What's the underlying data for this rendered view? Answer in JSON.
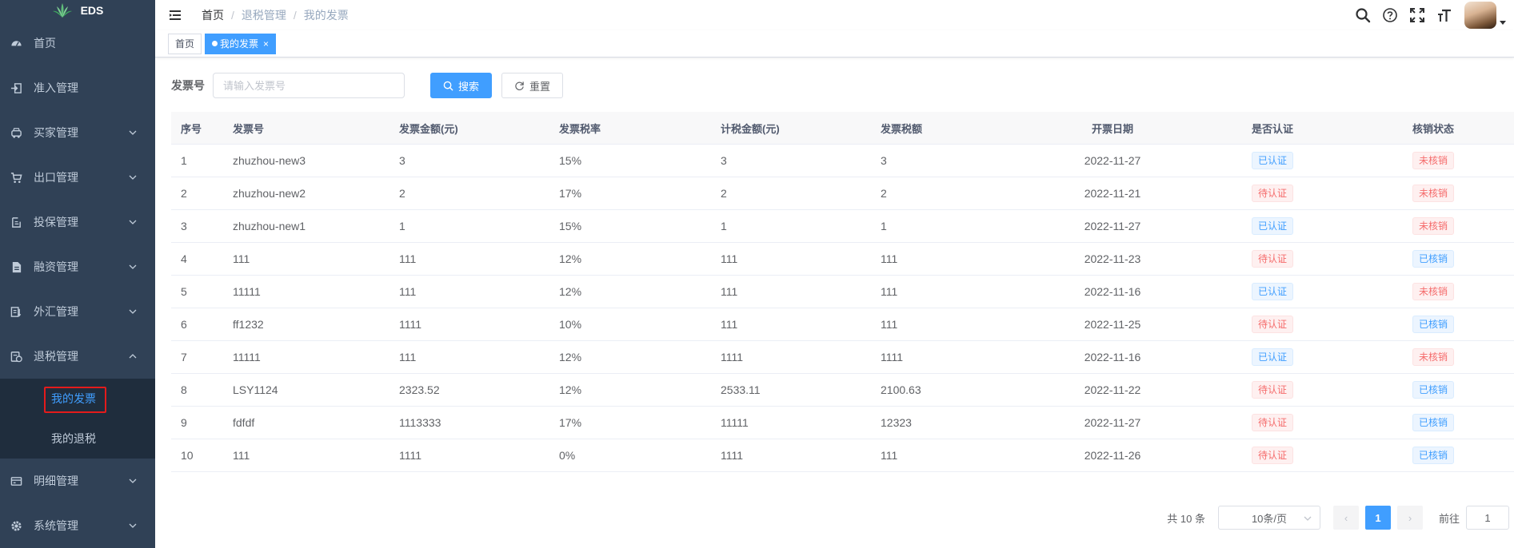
{
  "app": {
    "logo_text": "EDS"
  },
  "sidebar": {
    "items": [
      {
        "label": "首页",
        "icon": "dashboard-icon",
        "expandable": false
      },
      {
        "label": "准入管理",
        "icon": "entry-icon",
        "expandable": false
      },
      {
        "label": "买家管理",
        "icon": "buyer-icon",
        "expandable": true
      },
      {
        "label": "出口管理",
        "icon": "cart-icon",
        "expandable": true
      },
      {
        "label": "投保管理",
        "icon": "insurance-icon",
        "expandable": true
      },
      {
        "label": "融资管理",
        "icon": "finance-icon",
        "expandable": true
      },
      {
        "label": "外汇管理",
        "icon": "exchange-icon",
        "expandable": true
      },
      {
        "label": "退税管理",
        "icon": "tax-refund-icon",
        "expandable": true,
        "expanded": true
      }
    ],
    "submenu": [
      {
        "label": "我的发票",
        "active": true
      },
      {
        "label": "我的退税",
        "active": false
      }
    ],
    "items_after": [
      {
        "label": "明细管理",
        "icon": "detail-icon",
        "expandable": true
      },
      {
        "label": "系统管理",
        "icon": "system-icon",
        "expandable": true
      }
    ]
  },
  "header": {
    "breadcrumb": [
      "首页",
      "退税管理",
      "我的发票"
    ],
    "separator": "/"
  },
  "tags": [
    {
      "label": "首页",
      "active": false
    },
    {
      "label": "我的发票",
      "active": true,
      "close": "×"
    }
  ],
  "search": {
    "label": "发票号",
    "placeholder": "请输入发票号",
    "value": "",
    "search_label": "搜索",
    "reset_label": "重置"
  },
  "table": {
    "columns": [
      "序号",
      "发票号",
      "发票金额(元)",
      "发票税率",
      "计税金额(元)",
      "发票税额",
      "开票日期",
      "是否认证",
      "核销状态"
    ],
    "rows": [
      [
        "1",
        "zhuzhou-new3",
        "3",
        "15%",
        "3",
        "3",
        "2022-11-27",
        "已认证",
        "未核销"
      ],
      [
        "2",
        "zhuzhou-new2",
        "2",
        "17%",
        "2",
        "2",
        "2022-11-21",
        "待认证",
        "未核销"
      ],
      [
        "3",
        "zhuzhou-new1",
        "1",
        "15%",
        "1",
        "1",
        "2022-11-27",
        "已认证",
        "未核销"
      ],
      [
        "4",
        "111",
        "111",
        "12%",
        "111",
        "111",
        "2022-11-23",
        "待认证",
        "已核销"
      ],
      [
        "5",
        "11111",
        "111",
        "12%",
        "111",
        "111",
        "2022-11-16",
        "已认证",
        "未核销"
      ],
      [
        "6",
        "ff1232",
        "1111",
        "10%",
        "111",
        "111",
        "2022-11-25",
        "待认证",
        "已核销"
      ],
      [
        "7",
        "11111",
        "111",
        "12%",
        "1111",
        "1111",
        "2022-11-16",
        "已认证",
        "未核销"
      ],
      [
        "8",
        "LSY1124",
        "2323.52",
        "12%",
        "2533.11",
        "2100.63",
        "2022-11-22",
        "待认证",
        "已核销"
      ],
      [
        "9",
        "fdfdf",
        "1113333",
        "17%",
        "11111",
        "12323",
        "2022-11-27",
        "待认证",
        "已核销"
      ],
      [
        "10",
        "111",
        "1111",
        "0%",
        "1111",
        "111",
        "2022-11-26",
        "待认证",
        "已核销"
      ]
    ]
  },
  "pagination": {
    "total_text": "共 10 条",
    "page_size": "10条/页",
    "current_page": "1",
    "prev": "‹",
    "next": "›",
    "jump_label": "前往",
    "jump_value": "1"
  },
  "colors": {
    "sidebar_bg": "#304156",
    "submenu_bg": "#1f2d3d",
    "primary": "#409eff",
    "danger": "#f56c6c",
    "highlight_box": "#e41b1b"
  }
}
